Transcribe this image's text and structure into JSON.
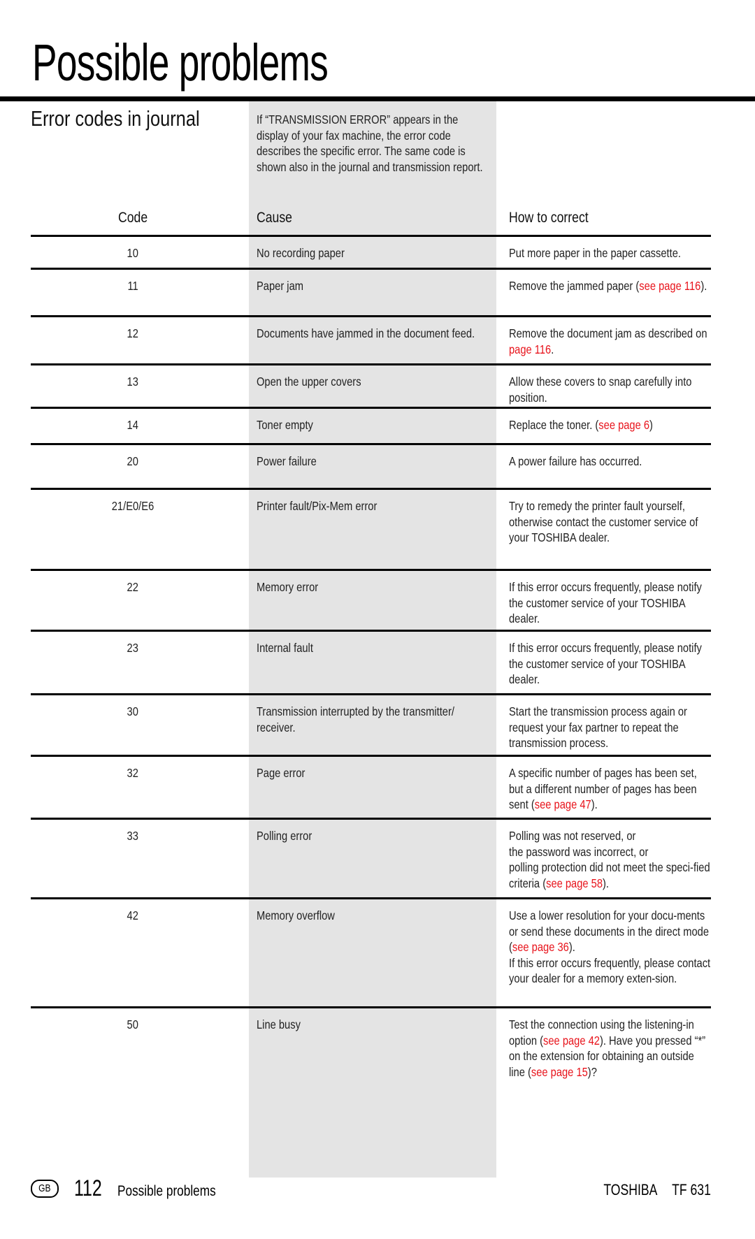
{
  "page": {
    "title": "Possible problems",
    "section_title": "Error codes in journal",
    "intro": "If “TRANSMISSION ERROR” appears in the display of your fax machine, the error code describes the specific error. The same code is shown also in the journal and transmission report."
  },
  "table": {
    "headers": {
      "code": "Code",
      "cause": "Cause",
      "correction": "How to correct"
    },
    "rows": [
      {
        "code": "10",
        "cause": "No recording paper",
        "correction": [
          {
            "text": "Put more paper in the paper cassette."
          }
        ]
      },
      {
        "code": "11",
        "cause": "Paper jam",
        "correction": [
          {
            "text": "Remove the jammed paper ("
          },
          {
            "text": "see page 116",
            "link": true
          },
          {
            "text": ")."
          }
        ]
      },
      {
        "code": "12",
        "cause": "Documents have jammed in the document feed.",
        "correction": [
          {
            "text": "Remove the document jam as described on "
          },
          {
            "text": "page 116",
            "link": true
          },
          {
            "text": "."
          }
        ]
      },
      {
        "code": "13",
        "cause": "Open the upper covers",
        "correction": [
          {
            "text": "Allow these covers to snap carefully into position."
          }
        ]
      },
      {
        "code": "14",
        "cause": "Toner empty",
        "correction": [
          {
            "text": "Replace the toner. ("
          },
          {
            "text": "see page 6",
            "link": true
          },
          {
            "text": ")"
          }
        ]
      },
      {
        "code": "20",
        "cause": "Power failure",
        "correction": [
          {
            "text": "A power failure has occurred."
          }
        ]
      },
      {
        "code": "21/E0/E6",
        "cause": "Printer fault/Pix-Mem error",
        "correction": [
          {
            "text": "Try to remedy the printer fault yourself, otherwise contact the customer service of your TOSHIBA dealer."
          }
        ]
      },
      {
        "code": "22",
        "cause": "Memory error",
        "correction": [
          {
            "text": "If this error occurs frequently, please notify the customer service of your TOSHIBA dealer."
          }
        ]
      },
      {
        "code": "23",
        "cause": "Internal fault",
        "correction": [
          {
            "text": "If this error occurs frequently, please notify the customer service of your TOSHIBA dealer."
          }
        ]
      },
      {
        "code": "30",
        "cause": "Transmission interrupted by the transmitter/ receiver.",
        "correction": [
          {
            "text": "Start the transmission process again or request your fax partner to repeat the transmission process."
          }
        ]
      },
      {
        "code": "32",
        "cause": "Page error",
        "correction": [
          {
            "text": "A specific number of pages has been set, but a different number of pages has been sent ("
          },
          {
            "text": "see page 47",
            "link": true
          },
          {
            "text": ")."
          }
        ]
      },
      {
        "code": "33",
        "cause": "Polling error",
        "correction": [
          {
            "text": "Polling was not reserved, or\nthe password was incorrect, or\npolling protection did not meet the speci-fied criteria ("
          },
          {
            "text": "see page 58",
            "link": true
          },
          {
            "text": ")."
          }
        ]
      },
      {
        "code": "42",
        "cause": "Memory overflow",
        "correction": [
          {
            "text": "Use a lower resolution for your docu-ments or send these documents in the direct mode ("
          },
          {
            "text": "see page 36",
            "link": true
          },
          {
            "text": ").\nIf this error occurs frequently, please contact your dealer for a memory exten-sion."
          }
        ]
      },
      {
        "code": "50",
        "cause": "Line busy",
        "correction": [
          {
            "text": "Test the connection using the listening-in option ("
          },
          {
            "text": "see page 42",
            "link": true
          },
          {
            "text": "). Have you pressed “*” on the extension for obtaining an outside line ("
          },
          {
            "text": "see page 15",
            "link": true
          },
          {
            "text": ")?"
          }
        ]
      }
    ]
  },
  "footer": {
    "language_badge": "GB",
    "page_number": "112",
    "section": "Possible problems",
    "brand": "TOSHIBA",
    "model": "TF 631"
  },
  "colors": {
    "link": "#e8141c",
    "shaded_column": "#e4e4e4",
    "rule": "#000000"
  }
}
